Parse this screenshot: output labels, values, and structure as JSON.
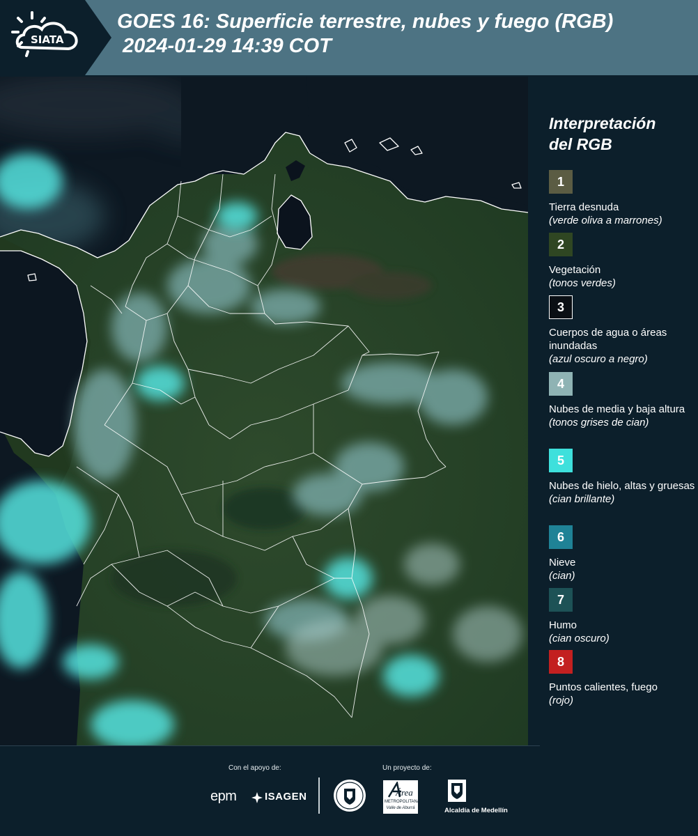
{
  "header": {
    "logo_text": "SIATA",
    "title_line1": "GOES 16: Superficie terrestre, nubes y fuego (RGB)",
    "title_line2": "2024-01-29 14:39 COT"
  },
  "legend": {
    "title_line1": "Interpretación",
    "title_line2": "del RGB",
    "items": [
      {
        "number": "1",
        "label": "Tierra desnuda",
        "note": "(verde oliva a marrones)",
        "color": "#5b5c43"
      },
      {
        "number": "2",
        "label": "Vegetación",
        "note": "(tonos verdes)",
        "color": "#2f4622"
      },
      {
        "number": "3",
        "label": "Cuerpos de agua o áreas inundadas",
        "note": "(azul oscuro a negro)",
        "color": "#0a0f14"
      },
      {
        "number": "4",
        "label": "Nubes de media y baja altura",
        "note": "(tonos grises de cian)",
        "color": "#8fb3b4"
      },
      {
        "number": "5",
        "label": "Nubes de hielo, altas y gruesas",
        "note": "(cian brillante)",
        "color": "#3ee0dc"
      },
      {
        "number": "6",
        "label": "Nieve",
        "note": "(cian)",
        "color": "#1f8296"
      },
      {
        "number": "7",
        "label": "Humo",
        "note": "(cian oscuro)",
        "color": "#1d5256"
      },
      {
        "number": "8",
        "label": "Puntos calientes, fuego",
        "note": "(rojo)",
        "color": "#c32020"
      }
    ]
  },
  "footer": {
    "support_caption": "Con el apoyo de:",
    "project_caption": "Un proyecto de:",
    "sponsor_epm": "epm",
    "sponsor_isagen": "ISAGEN",
    "partner_area_name": "Área",
    "partner_area_sub": "METROPOLITANA",
    "partner_area_tag": "Valle de Aburrá",
    "partner_alcaldia": "Alcaldía de Medellín"
  }
}
